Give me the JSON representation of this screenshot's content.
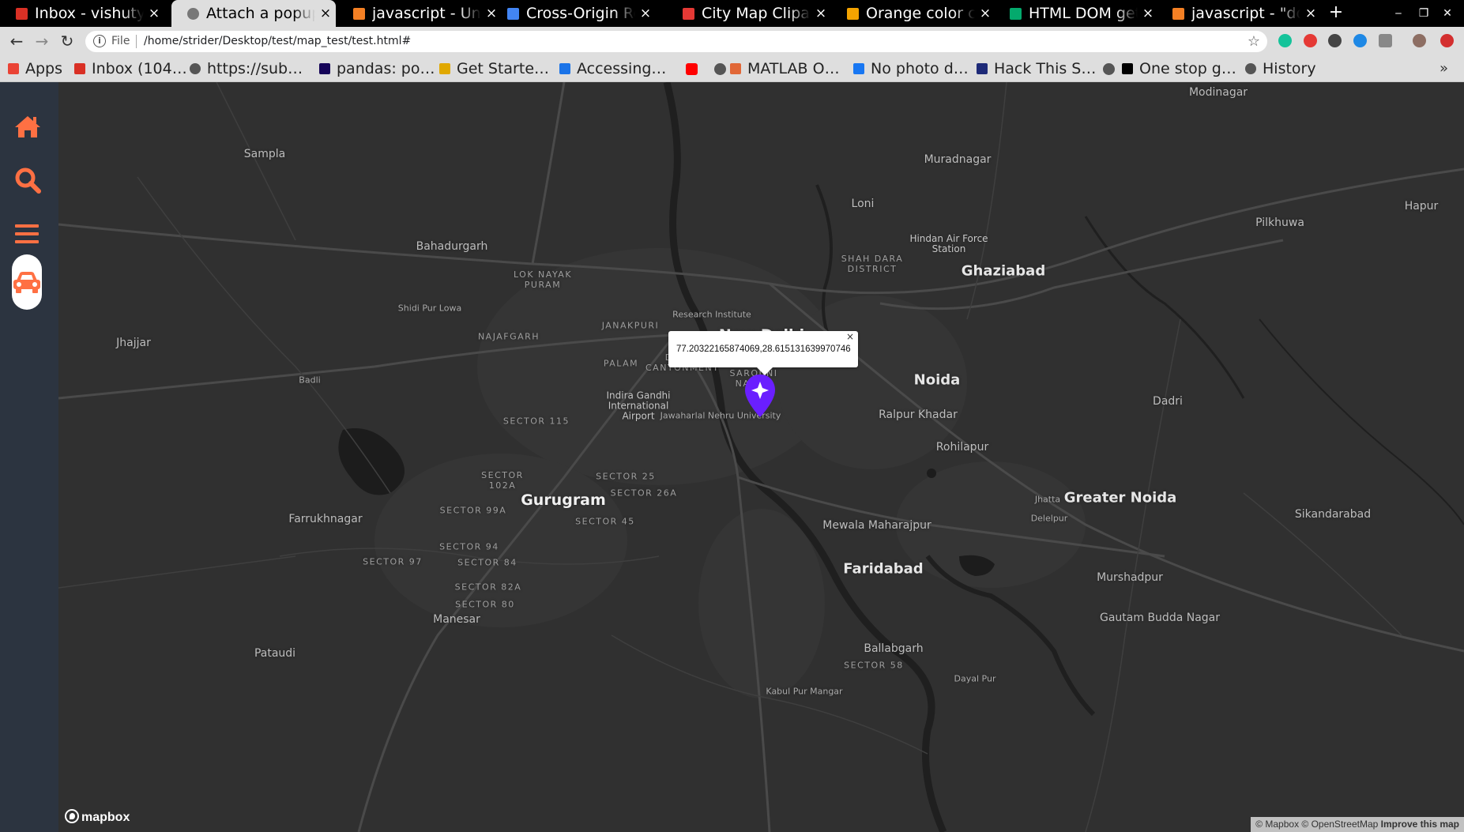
{
  "browser": {
    "tabs": [
      {
        "title": "Inbox - vishutyagi",
        "favicon": "gmail-icon",
        "active": false
      },
      {
        "title": "Attach a popup to a marker",
        "favicon": "globe-icon",
        "active": true
      },
      {
        "title": "javascript - Uncaught",
        "favicon": "stackoverflow-icon",
        "active": false
      },
      {
        "title": "Cross-Origin Read Blocking",
        "favicon": "chrome-icon",
        "active": false
      },
      {
        "title": "City Map Clipart,",
        "favicon": "clipart-icon",
        "active": false
      },
      {
        "title": "Orange color codes",
        "favicon": "r-icon",
        "active": false
      },
      {
        "title": "HTML DOM getElement",
        "favicon": "w3schools-icon",
        "active": false
      },
      {
        "title": "javascript - \"document",
        "favicon": "stackoverflow-icon",
        "active": false
      }
    ],
    "close_glyph": "×",
    "new_tab_glyph": "+",
    "window_controls": {
      "minimize": "‒",
      "restore": "❐",
      "close": "✕"
    },
    "nav": {
      "back": "←",
      "forward": "→",
      "reload": "↻"
    },
    "omnibox": {
      "scheme": "File",
      "url": "/home/strider/Desktop/test/map_test/test.html#",
      "star": "☆"
    },
    "bookmarks": [
      {
        "label": "Apps",
        "icon": "apps-grid-icon",
        "color": "#ea4335"
      },
      {
        "label": "Inbox (104…",
        "icon": "gmail-icon",
        "color": "#d93025"
      },
      {
        "label": "https://sub…",
        "icon": "globe-icon",
        "color": "#555555"
      },
      {
        "label": "pandas: po…",
        "icon": "pandas-icon",
        "color": "#150458"
      },
      {
        "label": "Get Starte…",
        "icon": "warning-icon",
        "color": "#e0a800"
      },
      {
        "label": "Accessing…",
        "icon": "infinity-icon",
        "color": "#1a73e8"
      },
      {
        "label": "",
        "icon": "youtube-icon",
        "color": "#ff0000"
      },
      {
        "label": "",
        "icon": "globe-icon",
        "color": "#555555"
      },
      {
        "label": "MATLAB O…",
        "icon": "matlab-icon",
        "color": "#e16737"
      },
      {
        "label": "No photo d…",
        "icon": "facebook-icon",
        "color": "#1877f2"
      },
      {
        "label": "Hack This S…",
        "icon": "hackthissite-icon",
        "color": "#1e2a78"
      },
      {
        "label": "",
        "icon": "globe-icon",
        "color": "#555555"
      },
      {
        "label": "One stop g…",
        "icon": "medium-icon",
        "color": "#000000"
      },
      {
        "label": "History",
        "icon": "history-icon",
        "color": "#555555"
      }
    ],
    "bookmarks_more": "»"
  },
  "sidebar": {
    "items": [
      {
        "name": "home",
        "icon": "home-icon"
      },
      {
        "name": "search",
        "icon": "search-icon"
      },
      {
        "name": "menu",
        "icon": "menu-icon"
      },
      {
        "name": "car",
        "icon": "car-icon"
      }
    ],
    "accent": "#ff7043"
  },
  "map": {
    "places": [
      {
        "name": "Modinagar",
        "kind": "town"
      },
      {
        "name": "Muradnagar",
        "kind": "town"
      },
      {
        "name": "Sampla",
        "kind": "town"
      },
      {
        "name": "Loni",
        "kind": "town"
      },
      {
        "name": "Hapur",
        "kind": "town"
      },
      {
        "name": "Pilkhuwa",
        "kind": "town"
      },
      {
        "name": "Hindan Air Force Station",
        "kind": "airport"
      },
      {
        "name": "Bahadurgarh",
        "kind": "town"
      },
      {
        "name": "SHAH DARA DISTRICT",
        "kind": "district"
      },
      {
        "name": "Ghaziabad",
        "kind": "city"
      },
      {
        "name": "LOK NAYAK PURAM",
        "kind": "district"
      },
      {
        "name": "Shidi Pur Lowa",
        "kind": "small"
      },
      {
        "name": "Research Institute",
        "kind": "small"
      },
      {
        "name": "JANAKPURI",
        "kind": "district"
      },
      {
        "name": "Jhajjar",
        "kind": "town"
      },
      {
        "name": "NAJAFGARH",
        "kind": "district"
      },
      {
        "name": "New Delhi",
        "kind": "big"
      },
      {
        "name": "DELHI CANTONMENT",
        "kind": "district"
      },
      {
        "name": "PALAM",
        "kind": "district"
      },
      {
        "name": "SAROJINI NAGAR",
        "kind": "district"
      },
      {
        "name": "Noida",
        "kind": "city"
      },
      {
        "name": "Badli",
        "kind": "small"
      },
      {
        "name": "Indira Gandhi International Airport",
        "kind": "airport"
      },
      {
        "name": "Jawaharlal Nehru University",
        "kind": "small"
      },
      {
        "name": "Ralpur Khadar",
        "kind": "town"
      },
      {
        "name": "Dadri",
        "kind": "town"
      },
      {
        "name": "SECTOR 115",
        "kind": "district"
      },
      {
        "name": "Rohilapur",
        "kind": "town"
      },
      {
        "name": "SECTOR 102A",
        "kind": "district"
      },
      {
        "name": "SECTOR 25",
        "kind": "district"
      },
      {
        "name": "SECTOR 26A",
        "kind": "district"
      },
      {
        "name": "Gurugram",
        "kind": "big"
      },
      {
        "name": "Jhatta",
        "kind": "small"
      },
      {
        "name": "Greater Noida",
        "kind": "city"
      },
      {
        "name": "SECTOR 99A",
        "kind": "district"
      },
      {
        "name": "Delelpur",
        "kind": "small"
      },
      {
        "name": "Sikandarabad",
        "kind": "town"
      },
      {
        "name": "Farrukhnagar",
        "kind": "town"
      },
      {
        "name": "SECTOR 45",
        "kind": "district"
      },
      {
        "name": "Mewala Maharajpur",
        "kind": "town"
      },
      {
        "name": "SECTOR 94",
        "kind": "district"
      },
      {
        "name": "SECTOR 97",
        "kind": "district"
      },
      {
        "name": "SECTOR 84",
        "kind": "district"
      },
      {
        "name": "Faridabad",
        "kind": "city"
      },
      {
        "name": "Murshadpur",
        "kind": "town"
      },
      {
        "name": "SECTOR 82A",
        "kind": "district"
      },
      {
        "name": "SECTOR 80",
        "kind": "district"
      },
      {
        "name": "Gautam Budda Nagar",
        "kind": "town"
      },
      {
        "name": "Manesar",
        "kind": "town"
      },
      {
        "name": "Ballabgarh",
        "kind": "town"
      },
      {
        "name": "Pataudi",
        "kind": "town"
      },
      {
        "name": "SECTOR 58",
        "kind": "district"
      },
      {
        "name": "Dayal Pur",
        "kind": "small"
      },
      {
        "name": "Kabul Pur Mangar",
        "kind": "small"
      }
    ],
    "popup": {
      "text": "77.20322165874069,28.615131639970746",
      "close": "×"
    },
    "marker_color": "#6a1fff",
    "logo": "mapbox",
    "attribution": {
      "text": "© Mapbox © OpenStreetMap",
      "link": "Improve this map"
    }
  }
}
